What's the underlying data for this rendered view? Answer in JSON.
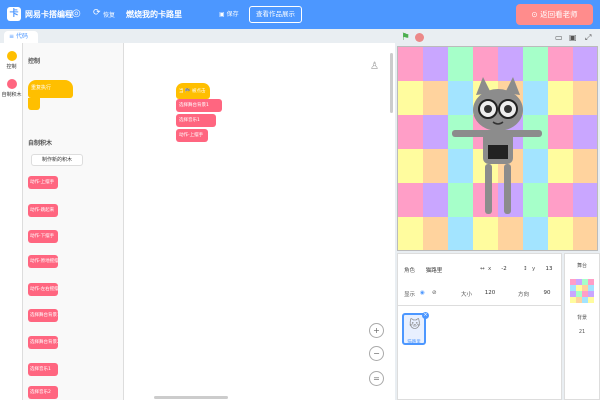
{
  "header": {
    "brand": "网易卡搭编程",
    "restore_label": "恢复",
    "project_name": "燃烧我的卡路里",
    "save_label": "保存",
    "view_button": "查看作品展示",
    "back_button": "返回看老师"
  },
  "tabs": {
    "code": "代码"
  },
  "categories": [
    {
      "label": "控制",
      "color": "#ffbf00"
    },
    {
      "label": "自制积木",
      "color": "#ff6680"
    }
  ],
  "palette": {
    "control_heading": "控制",
    "repeat_block": "重复执行",
    "custom_heading": "自制积木",
    "make_block_button": "制作新的积木",
    "blocks": [
      "动作-上摆手",
      "动作-跳起来",
      "动作-下摆手",
      "动作-原地摇摆",
      "动作-左右摇摆",
      "选择舞台背景1",
      "选择舞台背景2",
      "选择音乐1",
      "选择音乐2"
    ]
  },
  "script": {
    "hat": "当 🏁 被点击",
    "blocks": [
      "选择舞台背景1",
      "选择音乐1",
      "动作-上摆手"
    ]
  },
  "sprite": {
    "role_label": "角色",
    "name": "猫路里",
    "x_label": "x",
    "x_value": "-2",
    "y_label": "y",
    "y_value": "13",
    "show_label": "显示",
    "size_label": "大小",
    "size_value": "120",
    "direction_label": "方向",
    "direction_value": "90",
    "thumb_label": "猫路里"
  },
  "stage_panel": {
    "title": "舞台",
    "backdrop_label": "背景",
    "backdrop_count": "21"
  },
  "colors": {
    "accent": "#4c97ff",
    "events": "#ffbf00",
    "custom_blocks": "#ff6680",
    "back_button": "#ff8c8c"
  }
}
